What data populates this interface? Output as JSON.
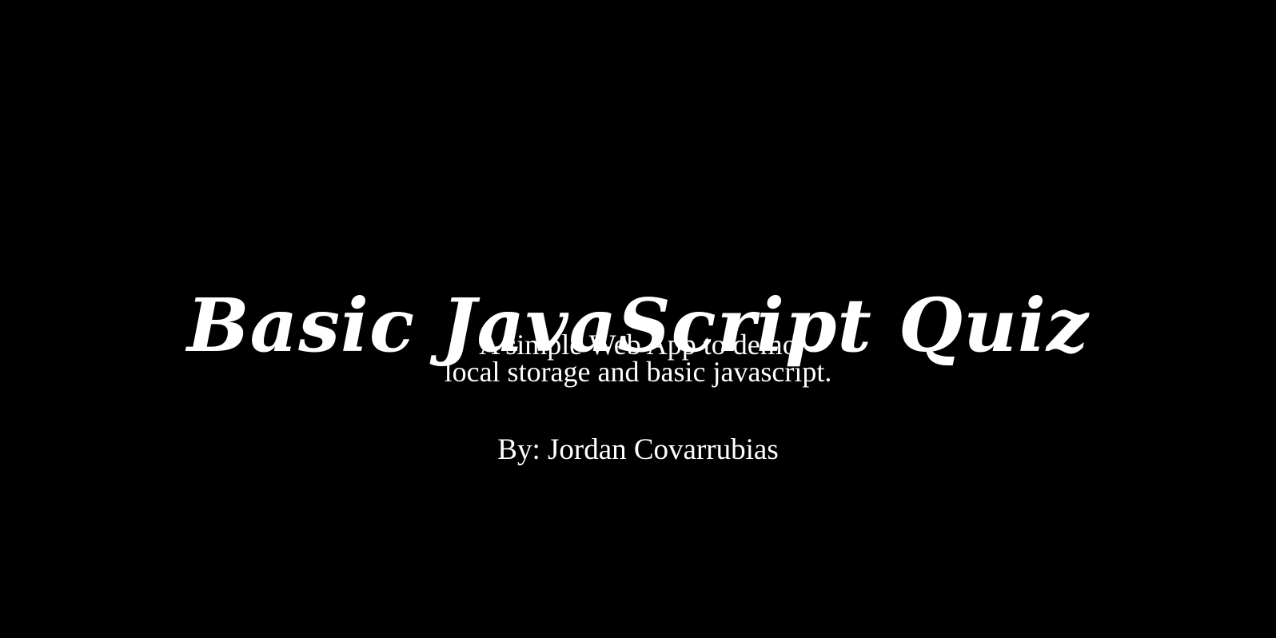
{
  "hero": {
    "title": "Basic JavaScript Quiz",
    "subtitle_line1": "A simple Web App to demo",
    "subtitle_line2": "local storage and basic javascript.",
    "author": "By: Jordan Covarrubias"
  },
  "colors": {
    "background": "#000000",
    "text": "#ffffff"
  }
}
